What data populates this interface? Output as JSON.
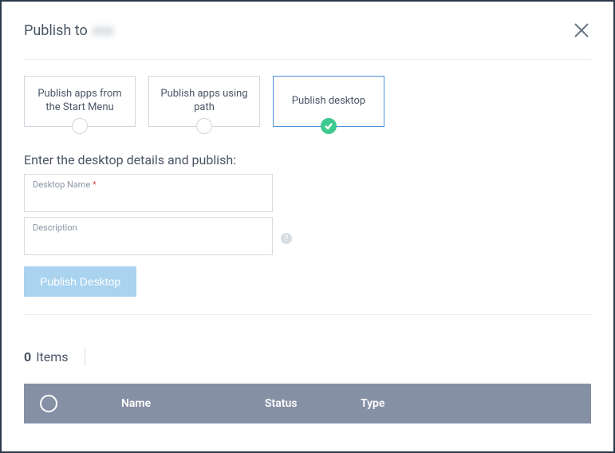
{
  "header": {
    "title_prefix": "Publish to",
    "title_target": "xxx"
  },
  "tabs": [
    {
      "label": "Publish apps from the Start Menu",
      "active": false
    },
    {
      "label": "Publish apps using path",
      "active": false
    },
    {
      "label": "Publish desktop",
      "active": true
    }
  ],
  "form": {
    "section_label": "Enter the desktop details and publish:",
    "desktop_name_label": "Desktop Name",
    "desktop_name_value": "",
    "description_label": "Description",
    "description_value": "",
    "publish_button": "Publish Desktop"
  },
  "list": {
    "count": "0",
    "count_label": "Items"
  },
  "table": {
    "col_name": "Name",
    "col_status": "Status",
    "col_type": "Type"
  }
}
